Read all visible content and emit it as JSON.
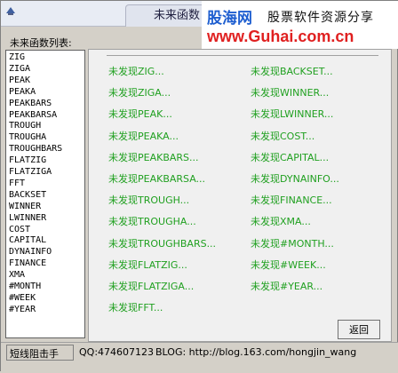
{
  "window": {
    "title": "未来函数"
  },
  "watermark": {
    "logo": "股海网",
    "slogan": "股票软件资源分享",
    "domain": "www.Guhai.com.cn"
  },
  "list": {
    "header": "未来函数列表:",
    "items": [
      "ZIG",
      "ZIGA",
      "PEAK",
      "PEAKA",
      "PEAKBARS",
      "PEAKBARSA",
      "TROUGH",
      "TROUGHA",
      "TROUGHBARS",
      "FLATZIG",
      "FLATZIGA",
      "FFT",
      "BACKSET",
      "WINNER",
      "LWINNER",
      "COST",
      "CAPITAL",
      "DYNAINFO",
      "FINANCE",
      "XMA",
      "#MONTH",
      "#WEEK",
      "#YEAR"
    ]
  },
  "results": {
    "col1": [
      "未发现ZIG...",
      "未发现ZIGA...",
      "未发现PEAK...",
      "未发现PEAKA...",
      "未发现PEAKBARS...",
      "未发现PEAKBARSA...",
      "未发现TROUGH...",
      "未发现TROUGHA...",
      "未发现TROUGHBARS...",
      "未发现FLATZIG...",
      "未发现FLATZIGA...",
      "未发现FFT..."
    ],
    "col2": [
      "未发现BACKSET...",
      "未发现WINNER...",
      "未发现LWINNER...",
      "未发现COST...",
      "未发现CAPITAL...",
      "未发现DYNAINFO...",
      "未发现FINANCE...",
      "未发现XMA...",
      "未发现#MONTH...",
      "未发现#WEEK...",
      "未发现#YEAR..."
    ],
    "color": "#20a020"
  },
  "buttons": {
    "back": "返回"
  },
  "status": {
    "author": "短线阻击手",
    "qq": "QQ:474607123",
    "blog": "BLOG: http://blog.163.com/hongjin_wang"
  }
}
